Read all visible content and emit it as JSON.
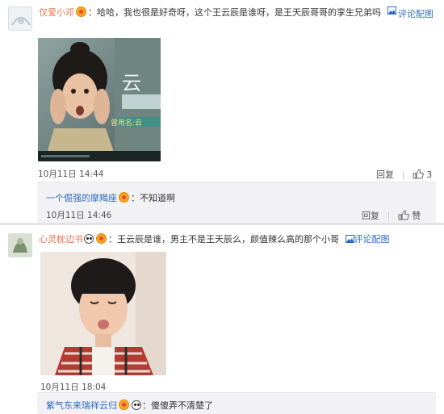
{
  "comments": [
    {
      "username": "仅爱小邓",
      "text": "：哈哈，我也很是好奇呀，这个王云辰是谁呀，是王天辰哥哥的孪生兄弟吗",
      "pic_link": "评论配图",
      "image_caption": "云",
      "image_subcaption": "曾用名:云",
      "timestamp": "10月11日 14:44",
      "reply_label": "回复",
      "like_count": "3",
      "replies": [
        {
          "username": "一个倔强的摩羯座",
          "text": "：不知道啊",
          "timestamp": "10月11日 14:46",
          "reply_label": "回复",
          "like_label": "赞"
        }
      ]
    },
    {
      "username": "心灵枕边书",
      "text": "：王云辰是谁，男主不是王天辰么，颜值辣么高的那个小哥",
      "pic_link": "评论配图",
      "timestamp": "10月11日 18:04",
      "replies": [
        {
          "username": "紫气东来瑞祥云归",
          "text": "：傻傻弄不清楚了"
        }
      ]
    }
  ],
  "colors": {
    "username": "#eb7350",
    "link": "#2d6bbf",
    "reply_bg": "#f2f2f5",
    "separator": "#e4e4e4"
  },
  "icons": {
    "verified_badge": "vip-badge-icon",
    "panda": "panda-emoji-icon",
    "picture": "picture-icon",
    "like": "thumbs-up-icon"
  }
}
